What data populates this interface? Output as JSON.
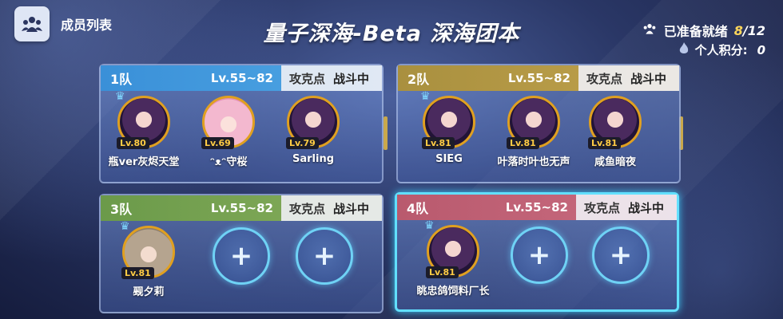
{
  "header": {
    "member_list_label": "成员列表",
    "title": "量子深海-Beta 深海团本",
    "ready_label": "已准备就绪",
    "ready_count": "8",
    "ready_total": "/12",
    "points_label": "个人积分:",
    "points_value": "0"
  },
  "teams": [
    {
      "name": "1队",
      "level_range": "Lv.55~82",
      "point_label": "攻克点",
      "status": "战斗中",
      "members": [
        {
          "name": "瓶ver灰烬天堂",
          "level": "Lv.80",
          "is_leader": true
        },
        {
          "name": "ᵔᴥᵔ守桜",
          "level": "Lv.69",
          "is_leader": false
        },
        {
          "name": "Sarling",
          "level": "Lv.79",
          "is_leader": false
        }
      ]
    },
    {
      "name": "2队",
      "level_range": "Lv.55~82",
      "point_label": "攻克点",
      "status": "战斗中",
      "members": [
        {
          "name": "SIEG",
          "level": "Lv.81",
          "is_leader": true
        },
        {
          "name": "叶落时叶也无声",
          "level": "Lv.81",
          "is_leader": false
        },
        {
          "name": "咸鱼暗夜",
          "level": "Lv.81",
          "is_leader": false
        }
      ]
    },
    {
      "name": "3队",
      "level_range": "Lv.55~82",
      "point_label": "攻克点",
      "status": "战斗中",
      "members": [
        {
          "name": "觋夕莉",
          "level": "Lv.81",
          "is_leader": true
        }
      ]
    },
    {
      "name": "4队",
      "level_range": "Lv.55~82",
      "point_label": "攻克点",
      "status": "战斗中",
      "members": [
        {
          "name": "眺忠鸽饲料厂长",
          "level": "Lv.81",
          "is_leader": true
        }
      ]
    }
  ],
  "colors": {
    "team1": "#3a90d8",
    "team2": "#a9903f",
    "team3": "#6b9a4a",
    "team4": "#b95a6e",
    "ready_count": "#ffd75a",
    "selected_border": "#62e0ff"
  },
  "icons": {
    "member_list": "group-icon",
    "ready": "group-icon",
    "points": "flame-icon",
    "leader": "crown-icon",
    "empty_slot": "plus-icon"
  }
}
